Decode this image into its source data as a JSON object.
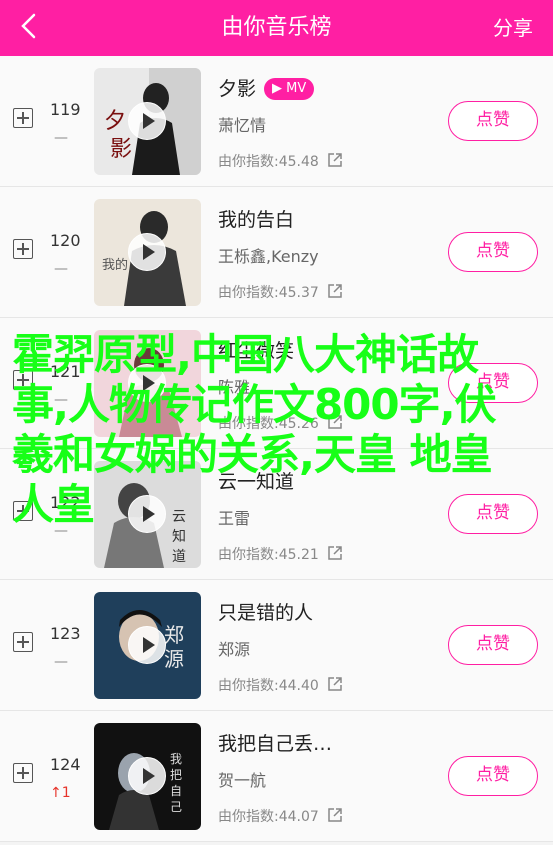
{
  "header": {
    "title": "由你音乐榜",
    "share_label": "分享",
    "background_color": "#ff1fa3"
  },
  "overlay_text": "霍羿原型,中国八大神话故事,人物传记作文800字,伏羲和女娲的关系,天皇 地皇 人皇",
  "rows": [
    {
      "rank": "119",
      "trend": "—",
      "title": "夕影",
      "has_mv": true,
      "mv_label": "MV",
      "artist": "萧忆情",
      "index": "由你指数:45.48",
      "like_label": "点赞"
    },
    {
      "rank": "120",
      "trend": "—",
      "title": "我的告白",
      "has_mv": false,
      "artist": "王栎鑫,Kenzy",
      "index": "由你指数:45.37",
      "like_label": "点赞"
    },
    {
      "rank": "121",
      "trend": "—",
      "title": "红尘微笑",
      "has_mv": false,
      "artist": "陈雅",
      "index": "由你指数:45.26",
      "like_label": "点赞"
    },
    {
      "rank": "122",
      "trend": "—",
      "title": "云一知道",
      "has_mv": false,
      "artist": "王雷",
      "index": "由你指数:45.21",
      "like_label": "点赞"
    },
    {
      "rank": "123",
      "trend": "—",
      "title": "只是错的人",
      "has_mv": false,
      "artist": "郑源",
      "index": "由你指数:44.40",
      "like_label": "点赞"
    },
    {
      "rank": "124",
      "trend": "↑1",
      "trend_up": true,
      "title": "我把自己丢…",
      "has_mv": false,
      "artist": "贺一航",
      "index": "由你指数:44.07",
      "like_label": "点赞"
    }
  ],
  "icons": [
    "back-chevron-icon",
    "add-icon",
    "play-icon",
    "external-link-icon"
  ]
}
